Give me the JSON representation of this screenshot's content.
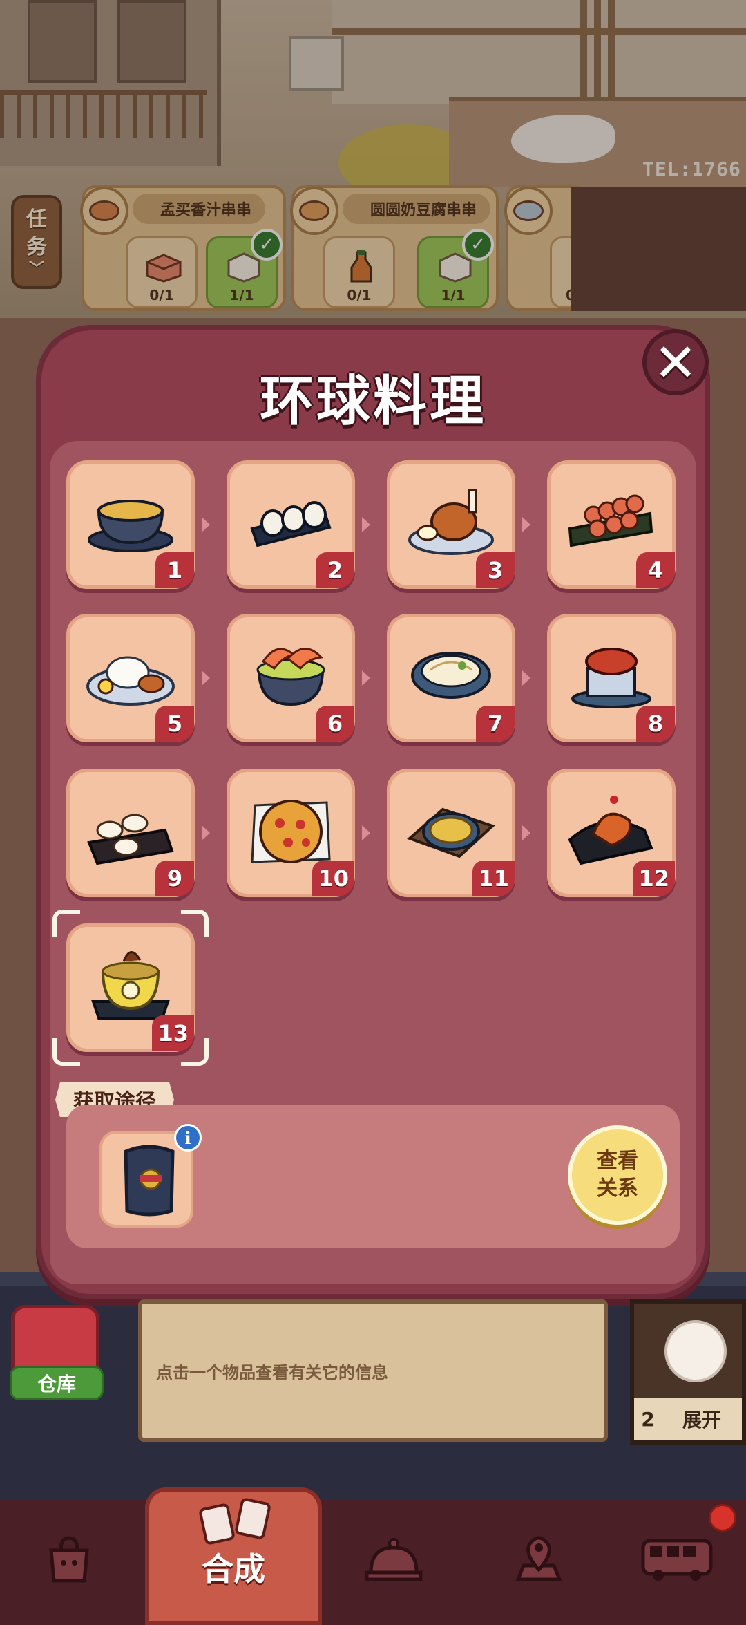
{
  "background": {
    "tel": "TEL:1766"
  },
  "tasks": {
    "toggle_label": "任务",
    "cards": [
      {
        "title": "孟买香汁串串",
        "requirements": [
          {
            "count": "0/1",
            "done": false
          },
          {
            "count": "1/1",
            "done": true
          }
        ]
      },
      {
        "title": "圆圆奶豆腐串串",
        "requirements": [
          {
            "count": "0/1",
            "done": false
          },
          {
            "count": "1/1",
            "done": true
          }
        ]
      },
      {
        "title": "",
        "requirements": [
          {
            "count": "0",
            "done": false
          }
        ]
      }
    ]
  },
  "modal": {
    "title": "环球料理",
    "close_icon": "close-icon",
    "chain": [
      {
        "level": "1",
        "icon": "stone-pot-soup-icon"
      },
      {
        "level": "2",
        "icon": "sushi-roll-icon"
      },
      {
        "level": "3",
        "icon": "roast-chicken-leg-icon"
      },
      {
        "level": "4",
        "icon": "meatball-skewers-icon"
      },
      {
        "level": "5",
        "icon": "chicken-rice-plate-icon"
      },
      {
        "level": "6",
        "icon": "shrimp-bowl-icon"
      },
      {
        "level": "7",
        "icon": "noodle-bowl-icon"
      },
      {
        "level": "8",
        "icon": "braised-pork-pot-icon"
      },
      {
        "level": "9",
        "icon": "egg-custard-cups-icon"
      },
      {
        "level": "10",
        "icon": "pizza-icon"
      },
      {
        "level": "11",
        "icon": "curry-plate-icon"
      },
      {
        "level": "12",
        "icon": "cake-board-icon"
      },
      {
        "level": "13",
        "icon": "buddha-jumps-over-wall-icon"
      }
    ],
    "selected_level": "13",
    "obtain_label": "获取途径",
    "source_icon": "chef-hat-icon",
    "info_icon": "info-icon",
    "view_relation_line1": "查看",
    "view_relation_line2": "关系"
  },
  "info_bar": {
    "warehouse_label": "仓库",
    "hint": "点击一个物品查看有关它的信息",
    "cat_count": "2",
    "expand_label": "展开"
  },
  "bottom_nav": {
    "items": [
      {
        "icon": "shop-bag-icon"
      },
      {
        "label": "合成",
        "icon": "merge-cards-icon",
        "active": true
      },
      {
        "icon": "service-bell-icon"
      },
      {
        "icon": "map-pin-icon"
      },
      {
        "icon": "bus-icon"
      }
    ]
  },
  "colors": {
    "modal_bg": "#8a3b49",
    "tile_bg": "#f3c3a3",
    "badge": "#b8323c",
    "accent_yellow": "#f7dc7c"
  }
}
